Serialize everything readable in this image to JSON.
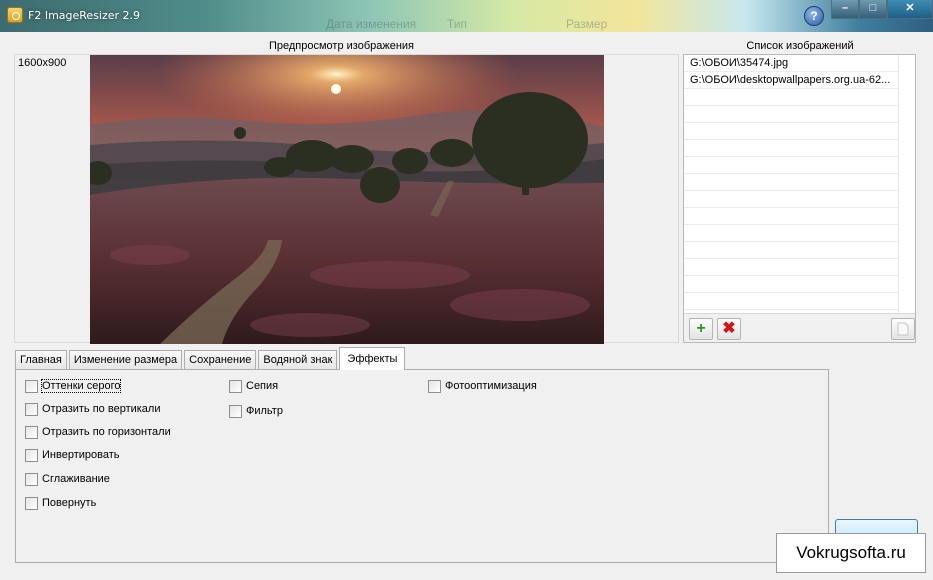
{
  "window": {
    "title": "F2 ImageResizer 2.9",
    "background_columns": [
      "Дата изменения",
      "Тип",
      "Размер"
    ],
    "help_label": "?",
    "minimize_label": "–",
    "maximize_label": "□",
    "close_label": "✕"
  },
  "preview": {
    "caption": "Предпросмотр изображения",
    "resolution": "1600x900"
  },
  "image_list": {
    "caption": "Список изображений",
    "items": [
      "G:\\ОБОИ\\35474.jpg",
      "G:\\ОБОИ\\desktopwallpapers.org.ua-62..."
    ],
    "add_icon": "+",
    "delete_icon": "✖"
  },
  "tabs": [
    {
      "label": "Главная",
      "active": false
    },
    {
      "label": "Изменение размера",
      "active": false
    },
    {
      "label": "Сохранение",
      "active": false
    },
    {
      "label": "Водяной знак",
      "active": false
    },
    {
      "label": "Эффекты",
      "active": true
    }
  ],
  "effects": {
    "col1": [
      "Оттенки серого",
      "Отразить по вертикали",
      "Отразить по горизонтали",
      "Инвертировать",
      "Сглаживание",
      "Повернуть"
    ],
    "col2": [
      "Сепия",
      "Фильтр"
    ],
    "col3": [
      "Фотооптимизация"
    ]
  },
  "watermark_text": "Vokrugsofta.ru",
  "colors": {
    "accent": "#3c7fb1",
    "add_green": "#2c9a1a",
    "delete_red": "#d41515"
  }
}
